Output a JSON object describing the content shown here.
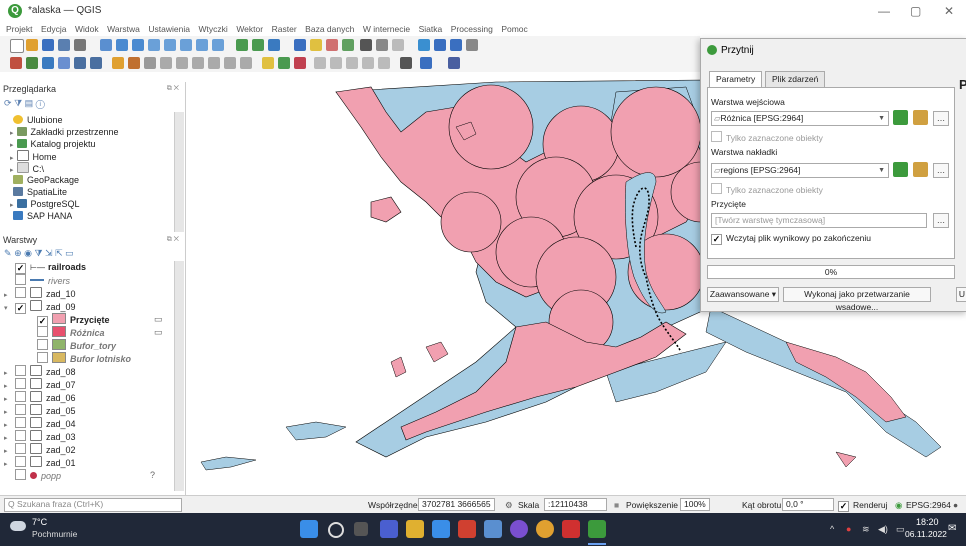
{
  "window": {
    "title": "*alaska — QGIS",
    "controls": {
      "minimize": "—",
      "maximize": "▢",
      "close": "✕"
    }
  },
  "menu": [
    "Projekt",
    "Edycja",
    "Widok",
    "Warstwa",
    "Ustawienia",
    "Wtyczki",
    "Wektor",
    "Raster",
    "Baza danych",
    "W internecie",
    "Siatka",
    "Processing",
    "Pomoc"
  ],
  "browser": {
    "title": "Przeglądarka",
    "items": [
      {
        "label": "Ulubione",
        "icon": "star-icon"
      },
      {
        "label": "Zakładki przestrzenne",
        "icon": "bookmark-icon"
      },
      {
        "label": "Katalog projektu",
        "icon": "folder-icon"
      },
      {
        "label": "Home",
        "icon": "home-icon"
      },
      {
        "label": "C:\\",
        "icon": "drive-icon"
      },
      {
        "label": "GeoPackage",
        "icon": "geopackage-icon"
      },
      {
        "label": "SpatiaLite",
        "icon": "spatialite-icon"
      },
      {
        "label": "PostgreSQL",
        "icon": "postgresql-icon"
      },
      {
        "label": "SAP HANA",
        "icon": "sap-hana-icon"
      }
    ]
  },
  "layers": {
    "title": "Warstwy",
    "rows": [
      {
        "label": "railroads",
        "indent": 0,
        "checked": true,
        "type": "line"
      },
      {
        "label": "rivers",
        "indent": 0,
        "checked": false,
        "type": "line-blue"
      },
      {
        "label": "zad_10",
        "indent": 0,
        "checked": false,
        "type": "group",
        "expander": "▸"
      },
      {
        "label": "zad_09",
        "indent": 0,
        "checked": true,
        "type": "group",
        "expander": "▾"
      },
      {
        "label": "Przycięte",
        "indent": 1,
        "checked": true,
        "type": "poly",
        "color": "#f1a0b0"
      },
      {
        "label": "Różnica",
        "indent": 1,
        "checked": false,
        "type": "poly",
        "color": "#e8506e"
      },
      {
        "label": "Bufor_tory",
        "indent": 1,
        "checked": false,
        "type": "poly",
        "color": "#8fb46a"
      },
      {
        "label": "Bufor lotnisko",
        "indent": 1,
        "checked": false,
        "type": "poly",
        "color": "#d8b860"
      },
      {
        "label": "zad_08",
        "indent": 0,
        "checked": false,
        "type": "group",
        "expander": "▸"
      },
      {
        "label": "zad_07",
        "indent": 0,
        "checked": false,
        "type": "group",
        "expander": "▸"
      },
      {
        "label": "zad_06",
        "indent": 0,
        "checked": false,
        "type": "group",
        "expander": "▸"
      },
      {
        "label": "zad_05",
        "indent": 0,
        "checked": false,
        "type": "group",
        "expander": "▸"
      },
      {
        "label": "zad_04",
        "indent": 0,
        "checked": false,
        "type": "group",
        "expander": "▸"
      },
      {
        "label": "zad_03",
        "indent": 0,
        "checked": false,
        "type": "group",
        "expander": "▸"
      },
      {
        "label": "zad_02",
        "indent": 0,
        "checked": false,
        "type": "group",
        "expander": "▸"
      },
      {
        "label": "zad_01",
        "indent": 0,
        "checked": false,
        "type": "group",
        "expander": "▸"
      },
      {
        "label": "popp",
        "indent": 0,
        "checked": false,
        "type": "point",
        "color": "#c0304a"
      }
    ]
  },
  "dialog": {
    "title": "Przytnij",
    "tabs": [
      "Parametry",
      "Plik zdarzeń"
    ],
    "input_layer_label": "Warstwa wejściowa",
    "input_layer_value": "Różnica [EPSG:2964]",
    "selected_only_1": "Tylko zaznaczone obiekty",
    "overlay_layer_label": "Warstwa nakładki",
    "overlay_layer_value": "regions [EPSG:2964]",
    "selected_only_2": "Tylko zaznaczone obiekty",
    "clipped_label": "Przycięte",
    "clipped_placeholder": "[Twórz warstwę tymczasową]",
    "load_result": "Wczytaj plik wynikowy po zakończeniu",
    "progress": "0%",
    "advanced_btn": "Zaawansowane ▾",
    "batch_btn": "Wykonaj jako przetwarzanie wsadowe...",
    "run_btn_partial": "U",
    "browse_btn": "…",
    "help_heading_partial": "P"
  },
  "statusbar": {
    "search_placeholder": "Q  Szukana fraza (Ctrl+K)",
    "coords_label": "Współrzędne",
    "coords_value": "3702781 3666565",
    "scale_label": "Skala",
    "scale_value": ":12110438",
    "magnifier_label": "Powiększenie",
    "magnifier_value": "100%",
    "rotation_label": "Kąt obrotu",
    "rotation_value": "0,0 °",
    "render_label": "Renderuj",
    "crs": "EPSG:2964"
  },
  "taskbar": {
    "weather_temp": "7°C",
    "weather_desc": "Pochmurnie",
    "time": "18:20",
    "date": "06.11.2022"
  },
  "colors": {
    "water_fill": "#a7cde3",
    "land_fill": "#f1a0b0",
    "outline": "#000000",
    "accent": "#3c9a3c"
  }
}
